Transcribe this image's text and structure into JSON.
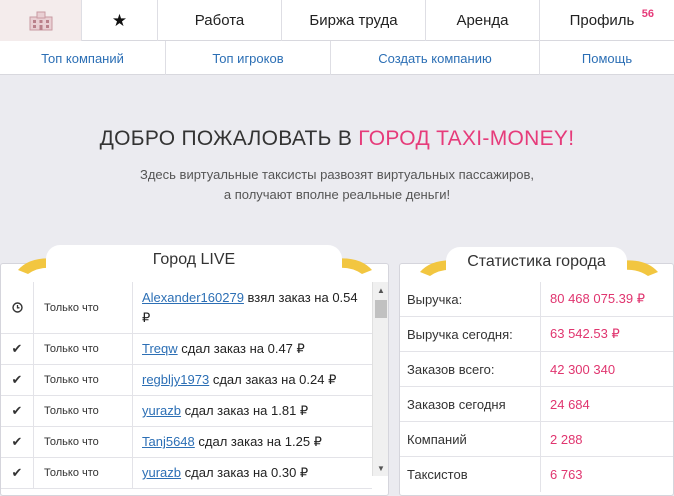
{
  "topnav": {
    "work": "Работа",
    "labor_exchange": "Биржа труда",
    "rent": "Аренда",
    "profile": "Профиль",
    "profile_badge": "56"
  },
  "subnav": {
    "top_companies": "Топ компаний",
    "top_players": "Топ игроков",
    "create_company": "Создать компанию",
    "help": "Помощь"
  },
  "hero": {
    "title_prefix": "ДОБРО ПОЖАЛОВАТЬ В ",
    "title_accent": "ГОРОД TAXI-MONEY!",
    "line1": "Здесь виртуальные таксисты развозят виртуальных пассажиров,",
    "line2": "а получают вполне реальные деньги!"
  },
  "live": {
    "title": "Город LIVE",
    "rows": [
      {
        "icon": "clock-icon",
        "time": "Только что",
        "user": "Alexander160279",
        "text": " взял заказ на 0.54 ₽"
      },
      {
        "icon": "check-icon",
        "time": "Только что",
        "user": "Treqw",
        "text": " сдал заказ на 0.47 ₽"
      },
      {
        "icon": "check-icon",
        "time": "Только что",
        "user": "regbljy1973",
        "text": " сдал заказ на 0.24 ₽"
      },
      {
        "icon": "check-icon",
        "time": "Только что",
        "user": "yurazb",
        "text": " сдал заказ на 1.81 ₽"
      },
      {
        "icon": "check-icon",
        "time": "Только что",
        "user": "Tanj5648",
        "text": " сдал заказ на 1.25 ₽"
      },
      {
        "icon": "check-icon",
        "time": "Только что",
        "user": "yurazb",
        "text": " сдал заказ на 0.30 ₽"
      }
    ]
  },
  "stats": {
    "title": "Статистика города",
    "rows": [
      {
        "label": "Выручка:",
        "value": "80 468 075.39 ₽"
      },
      {
        "label": "Выручка сегодня:",
        "value": "63 542.53 ₽"
      },
      {
        "label": "Заказов всего:",
        "value": "42 300 340"
      },
      {
        "label": "Заказов сегодня",
        "value": "24 684"
      },
      {
        "label": "Компаний",
        "value": "2 288"
      },
      {
        "label": "Таксистов",
        "value": "6 763"
      }
    ]
  },
  "colors": {
    "accent": "#e63b7a",
    "link": "#2c6fb5",
    "gold": "#f2c640",
    "background": "#ebebf0"
  }
}
